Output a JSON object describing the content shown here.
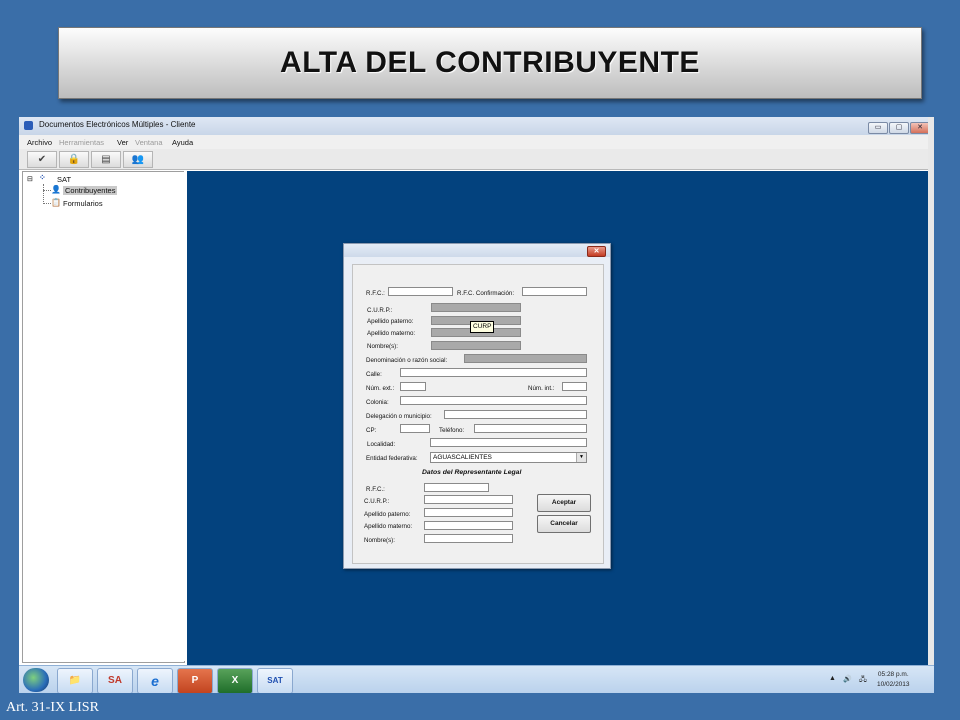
{
  "slide": {
    "title": "ALTA DEL CONTRIBUYENTE",
    "footer": "Art. 31-IX LISR"
  },
  "window": {
    "title": "Documentos Electrónicos Múltiples - Cliente",
    "controls": {
      "minimize": "▭",
      "maximize": "▢",
      "close": "✕"
    }
  },
  "menu": {
    "items": [
      {
        "label": "Archivo",
        "enabled": true
      },
      {
        "label": "Herramientas",
        "enabled": false
      },
      {
        "label": "Ver",
        "enabled": true
      },
      {
        "label": "Ventana",
        "enabled": false
      },
      {
        "label": "Ayuda",
        "enabled": true
      }
    ]
  },
  "toolbar": {
    "buttons": [
      {
        "icon": "check-icon",
        "glyph": "✔"
      },
      {
        "icon": "lock-icon",
        "glyph": "🔒"
      },
      {
        "icon": "document-icon",
        "glyph": "▤"
      },
      {
        "icon": "users-icon",
        "glyph": "👥"
      }
    ]
  },
  "tree": {
    "root": {
      "label": "SAT",
      "expander": "⊟"
    },
    "children": [
      {
        "label": "Contribuyentes",
        "selected": true
      },
      {
        "label": "Formularios",
        "selected": false
      }
    ]
  },
  "dialog": {
    "close": "✕",
    "fields": {
      "rfc": {
        "label": "R.F.C.:",
        "value": ""
      },
      "rfc_confirm": {
        "label": "R.F.C. Confirmación:",
        "value": ""
      },
      "curp": {
        "label": "C.U.R.P.:",
        "value": ""
      },
      "apellido_paterno": {
        "label": "Apellido paterno:",
        "value": ""
      },
      "apellido_materno": {
        "label": "Apellido materno:",
        "value": ""
      },
      "nombres": {
        "label": "Nombre(s):",
        "value": ""
      },
      "denominacion": {
        "label": "Denominación o razón social:",
        "value": ""
      },
      "calle": {
        "label": "Calle:",
        "value": ""
      },
      "num_ext": {
        "label": "Núm. ext.:",
        "value": ""
      },
      "num_int": {
        "label": "Núm. int.:",
        "value": ""
      },
      "colonia": {
        "label": "Colonia:",
        "value": ""
      },
      "delegacion": {
        "label": "Delegación o municipio:",
        "value": ""
      },
      "cp": {
        "label": "CP:",
        "value": ""
      },
      "telefono": {
        "label": "Teléfono:",
        "value": ""
      },
      "localidad": {
        "label": "Localidad:",
        "value": ""
      },
      "entidad": {
        "label": "Entidad federativa:",
        "value": "AGUASCALIENTES"
      }
    },
    "tooltip": "CURP",
    "rep_section": {
      "title": "Datos del Representante Legal",
      "rfc": {
        "label": "R.F.C.:",
        "value": ""
      },
      "curp": {
        "label": "C.U.R.P.:",
        "value": ""
      },
      "apellido_paterno": {
        "label": "Apellido paterno:",
        "value": ""
      },
      "apellido_materno": {
        "label": "Apellido materno:",
        "value": ""
      },
      "nombres": {
        "label": "Nombre(s):",
        "value": ""
      }
    },
    "buttons": {
      "accept": "Aceptar",
      "cancel": "Cancelar"
    }
  },
  "taskbar": {
    "items": [
      {
        "name": "explorer",
        "glyph": "📁"
      },
      {
        "name": "sa-app",
        "glyph": "SA"
      },
      {
        "name": "internet-explorer",
        "glyph": "e"
      },
      {
        "name": "powerpoint",
        "glyph": "P"
      },
      {
        "name": "excel",
        "glyph": "X"
      },
      {
        "name": "sat-app",
        "glyph": "SAT"
      }
    ],
    "tray": {
      "arrow": "▲",
      "volume": "🔊",
      "network": "🖧"
    },
    "clock": {
      "time": "05:28 p.m.",
      "date": "10/02/2013"
    }
  },
  "colors": {
    "background": "#3a6ea8",
    "workspace": "#03427e",
    "readonly_field": "#a9a9a9"
  }
}
